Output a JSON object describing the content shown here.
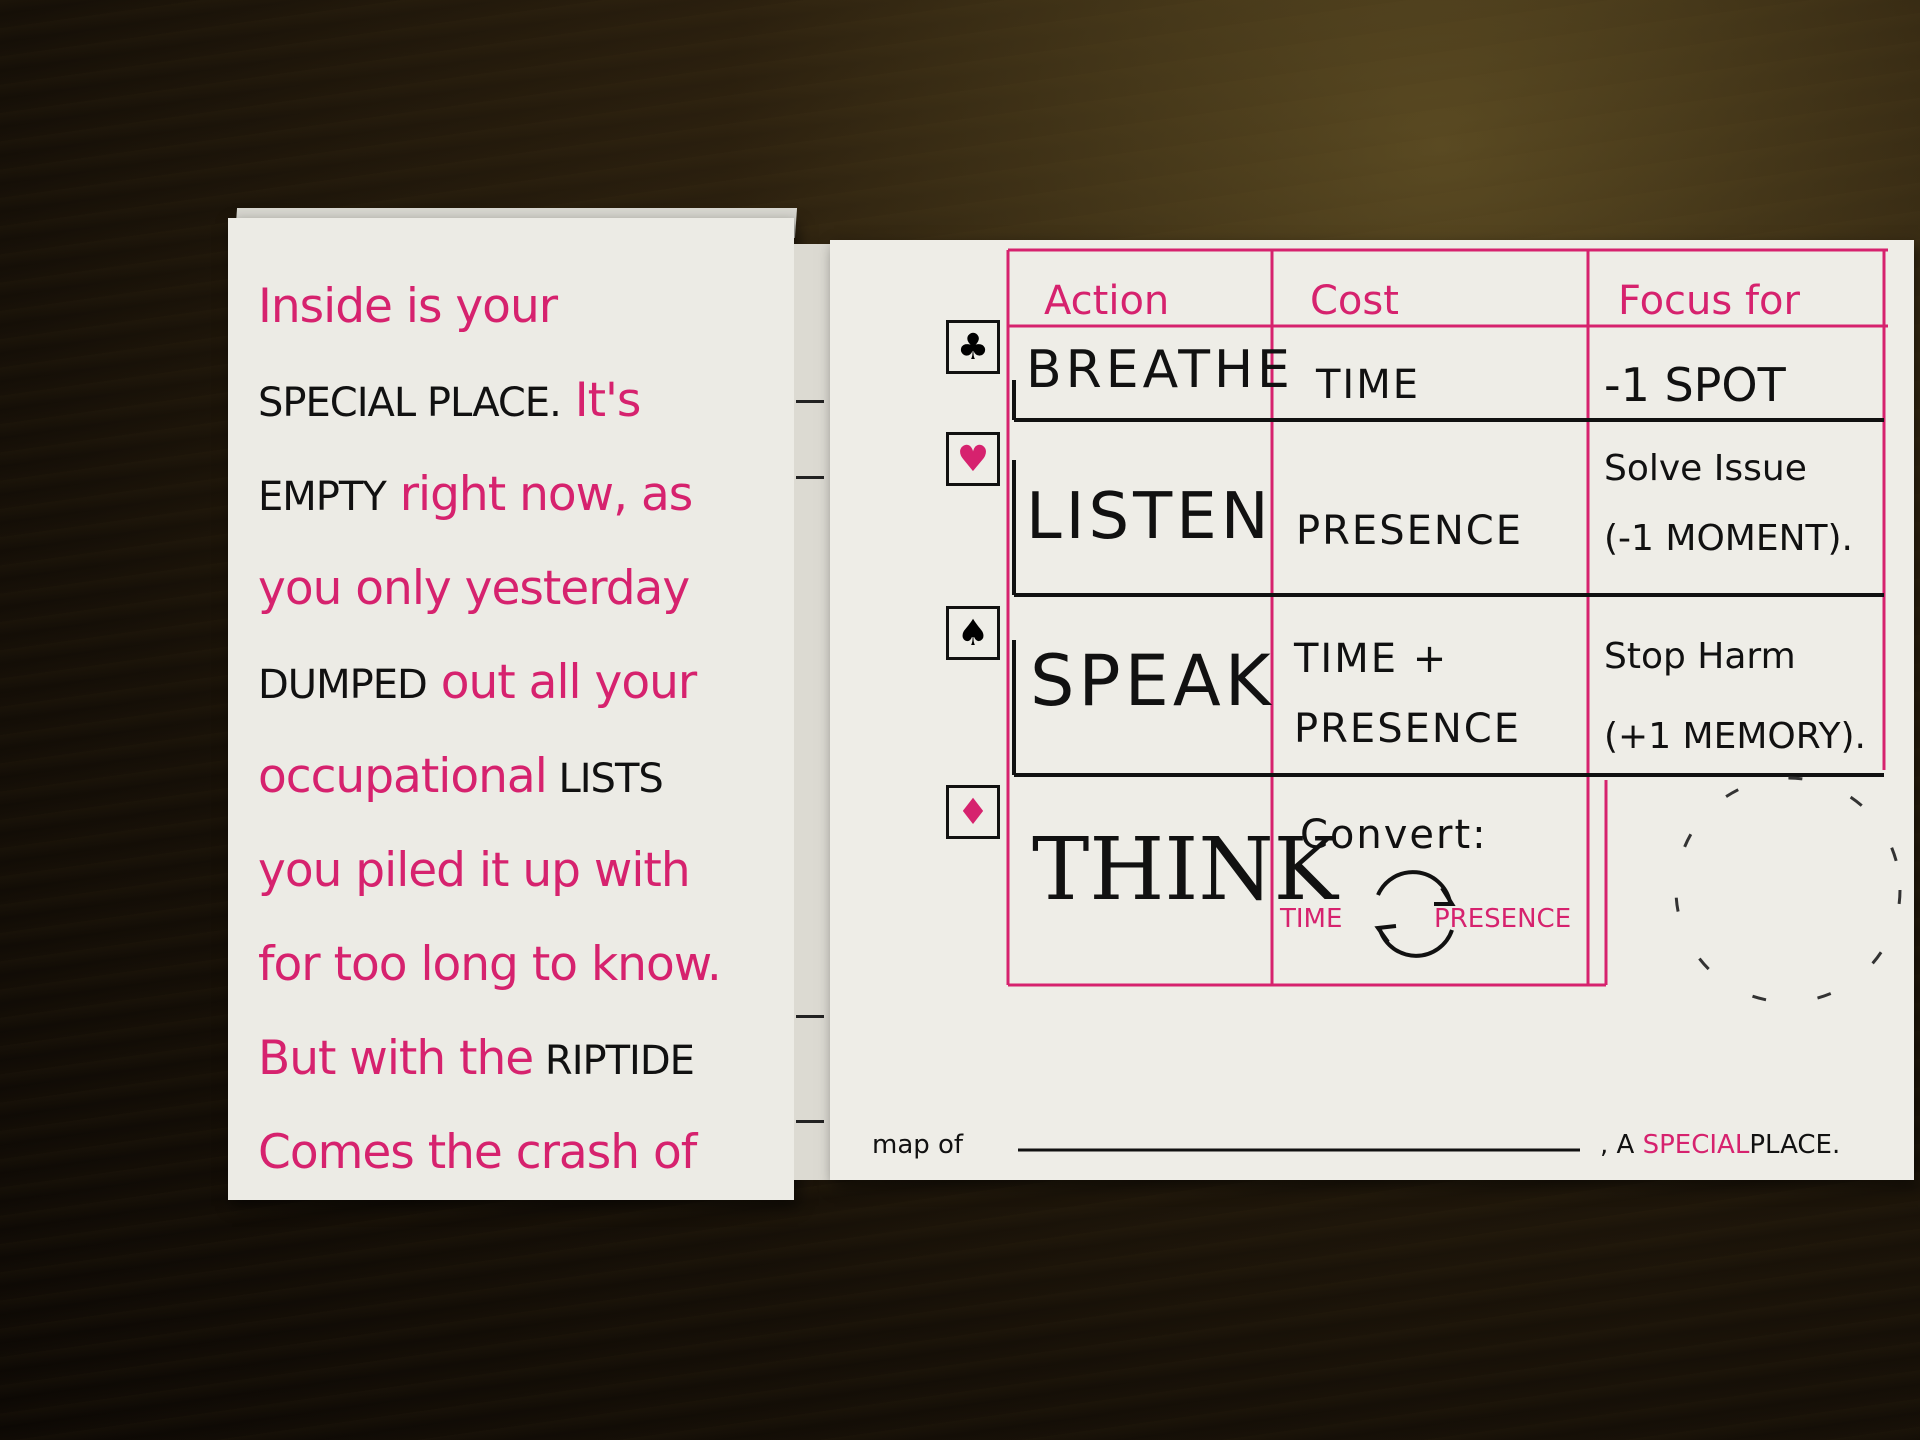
{
  "left_card": {
    "lines": [
      [
        {
          "t": "Inside is your",
          "c": "pink"
        }
      ],
      [
        {
          "t": "SPECIAL PLACE.",
          "c": "black"
        },
        {
          "t": " It's",
          "c": "pink"
        }
      ],
      [
        {
          "t": "EMPTY",
          "c": "black"
        },
        {
          "t": " right now, as",
          "c": "pink"
        }
      ],
      [
        {
          "t": "you only yesterday",
          "c": "pink"
        }
      ],
      [
        {
          "t": "DUMPED",
          "c": "black"
        },
        {
          "t": " out all your",
          "c": "pink"
        }
      ],
      [
        {
          "t": "occupational",
          "c": "pink"
        },
        {
          "t": " LISTS",
          "c": "black"
        }
      ],
      [
        {
          "t": "you piled it up with",
          "c": "pink"
        }
      ],
      [
        {
          "t": "for too long to know.",
          "c": "pink"
        }
      ],
      [
        {
          "t": "But with the",
          "c": "pink"
        },
        {
          "t": " RIPTIDE",
          "c": "black"
        }
      ],
      [
        {
          "t": "Comes the crash of",
          "c": "pink"
        }
      ]
    ]
  },
  "table": {
    "headers": {
      "action": "Action",
      "cost": "Cost",
      "focus": "Focus for"
    },
    "rows": [
      {
        "suit": "♣",
        "suit_color": "#111111",
        "action": "BREATHE",
        "cost": "TIME",
        "focus": [
          "-1 SPOT"
        ]
      },
      {
        "suit": "♥",
        "suit_color": "#d6226e",
        "action": "LISTEN",
        "cost": "PRESENCE",
        "focus": [
          "Solve Issue",
          "(-1 MOMENT)."
        ]
      },
      {
        "suit": "♠",
        "suit_color": "#111111",
        "action": "SPEAK",
        "cost_lines": [
          "TIME +",
          "PRESENCE"
        ],
        "focus": [
          "Stop Harm",
          "(+1 MEMORY)."
        ]
      },
      {
        "suit": "♦",
        "suit_color": "#d6226e",
        "action": "THINK",
        "cost_label": "Convert:",
        "convert_from": "TIME",
        "convert_to": "PRESENCE",
        "focus": []
      }
    ]
  },
  "footer": {
    "prefix": "map of",
    "suffix_black": ", A",
    "suffix_pink": "SPECIAL",
    "suffix_black2": "PLACE."
  },
  "colors": {
    "ink_pink": "#d6226e",
    "ink_black": "#111111",
    "paper": "#eeede7"
  }
}
